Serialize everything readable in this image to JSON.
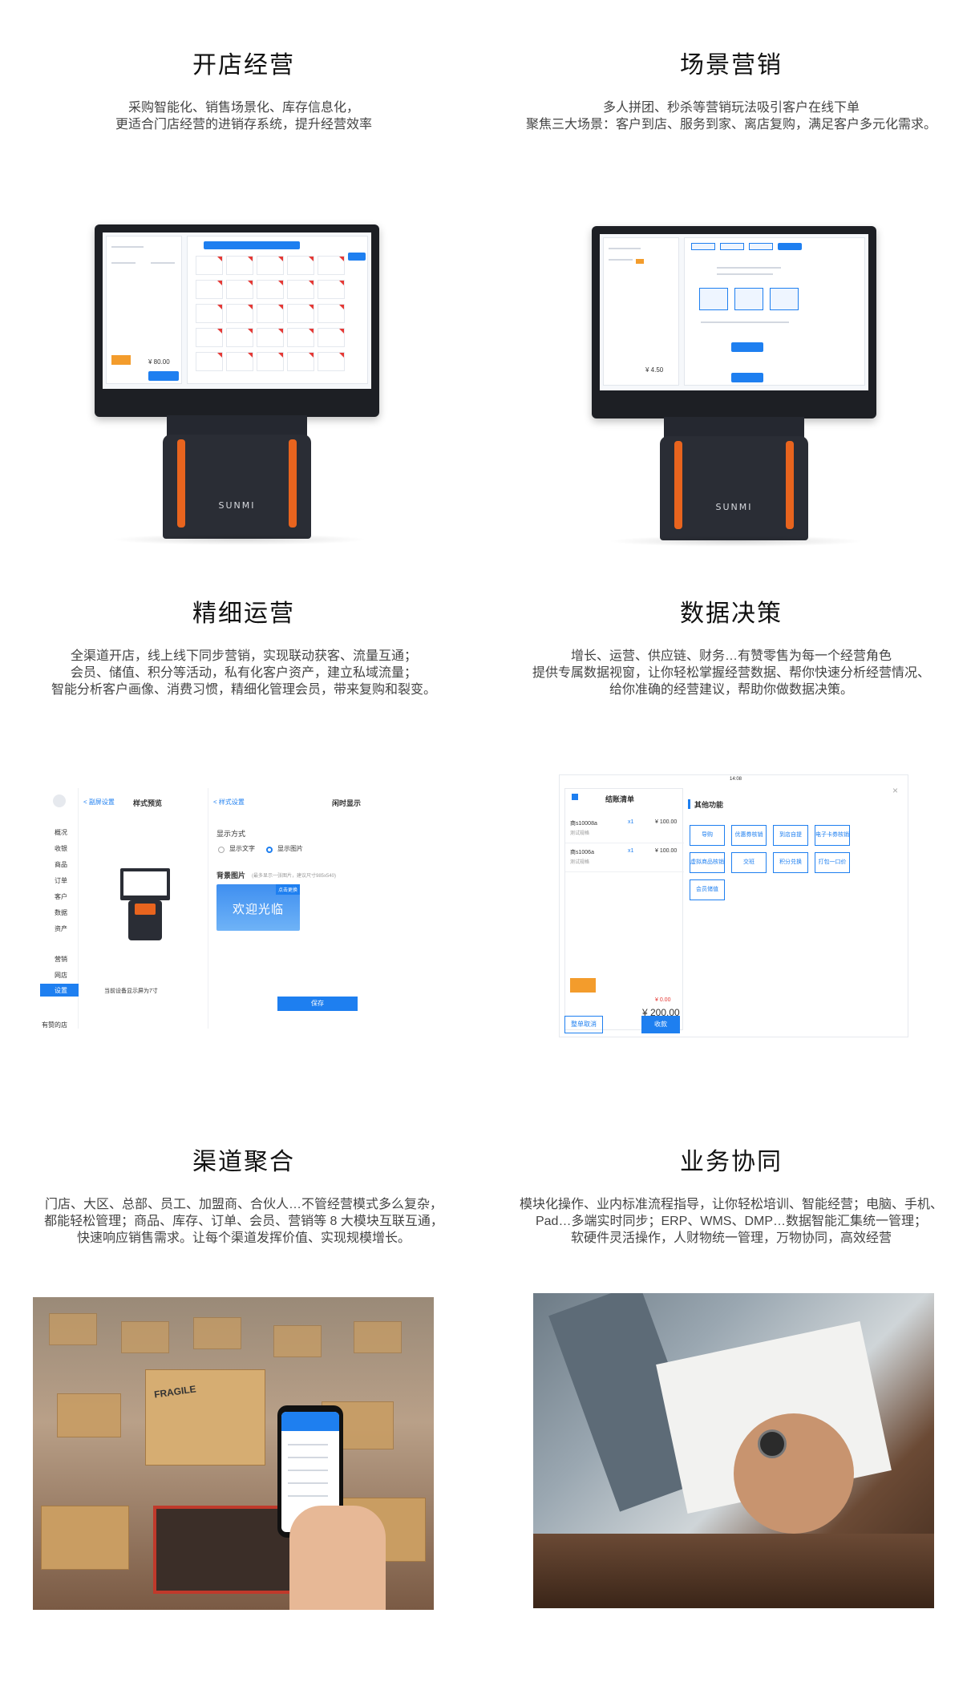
{
  "sections": [
    {
      "title": "开店经营",
      "lines": [
        "采购智能化、销售场景化、库存信息化，",
        "更适合门店经营的进销存系统，提升经营效率"
      ]
    },
    {
      "title": "场景营销",
      "lines": [
        "多人拼团、秒杀等营销玩法吸引客户在线下单",
        "聚焦三大场景：客户到店、服务到家、离店复购，满足客户多元化需求。"
      ]
    },
    {
      "title": "精细运营",
      "lines": [
        "全渠道开店，线上线下同步营销，实现联动获客、流量互通；",
        "会员、储值、积分等活动，私有化客户资产，建立私域流量；",
        "智能分析客户画像、消费习惯，精细化管理会员，带来复购和裂变。"
      ]
    },
    {
      "title": "数据决策",
      "lines": [
        "增长、运营、供应链、财务…有赞零售为每一个经营角色",
        "提供专属数据视窗，让你轻松掌握经营数据、帮你快速分析经营情况、",
        "给你准确的经营建议，帮助你做数据决策。"
      ]
    },
    {
      "title": "渠道聚合",
      "lines": [
        "门店、大区、总部、员工、加盟商、合伙人…不管经营模式多么复杂，",
        "都能轻松管理；商品、库存、订单、会员、营销等 8 大模块互联互通，",
        "快速响应销售需求。让每个渠道发挥价值、实现规模增长。"
      ]
    },
    {
      "title": "业务协同",
      "lines": [
        "模块化操作、业内标准流程指导，让你轻松培训、智能经营；电脑、手机、",
        "Pad…多端实时同步；ERP、WMS、DMP…数据智能汇集统一管理；",
        "软硬件灵活操作，人财物统一管理，万物协同，高效经营"
      ]
    }
  ],
  "pos_brand": "SUNMI",
  "pos1": {
    "total": "¥ 80.00"
  },
  "pos2": {
    "total": "¥ 4.50"
  },
  "ipad1": {
    "back_left": "< 副屏设置",
    "title_left": "样式预览",
    "back_right": "< 样式设置",
    "title_right": "闲时显示",
    "display_mode": "显示方式",
    "opt_text": "显示文字",
    "opt_image": "显示图片",
    "bg_label": "背景图片",
    "bg_hint": "(最多显示一张图片，建议尺寸985x540)",
    "welcome": "欢迎光临",
    "change_btn": "点击更换",
    "caption": "当前设备显示屏为7寸",
    "save": "保存",
    "store": "有赞的店",
    "menu": [
      "概况",
      "收银",
      "商品",
      "订单",
      "客户",
      "数据",
      "资产",
      "营销",
      "网店",
      "设置"
    ]
  },
  "ipad2": {
    "title": "结账清单",
    "time": "14:08",
    "section": "其他功能",
    "items": [
      {
        "name": "商s10008a",
        "spec": "测试规格",
        "qty": "x1",
        "price": "¥ 100.00"
      },
      {
        "name": "商s1006a",
        "spec": "测试规格",
        "qty": "x1",
        "price": "¥ 100.00"
      }
    ],
    "discount": "¥ 0.00",
    "total": "¥ 200.00",
    "cancel": "整单取消",
    "pay": "收款",
    "functions": [
      "导购",
      "优惠券核销",
      "到店自提",
      "电子卡券核销",
      "虚拟商品核销",
      "交班",
      "积分兑换",
      "打包一口价",
      "会员储值"
    ]
  },
  "photo1": {
    "box_label": "FRAGILE"
  }
}
